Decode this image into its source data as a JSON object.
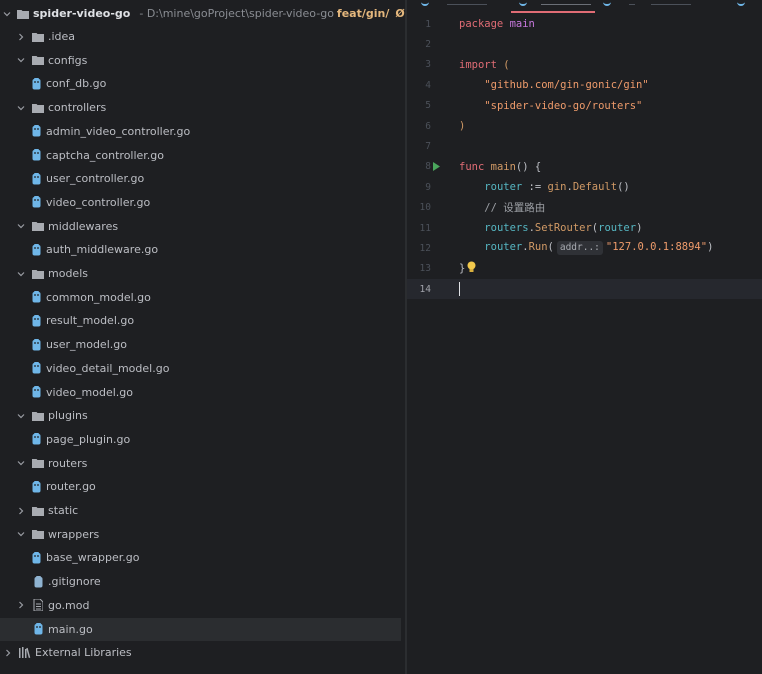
{
  "project": {
    "root_name": "spider-video-go",
    "root_path": "- D:\\mine\\goProject\\spider-video-go",
    "branch": "feat/gin/",
    "branch_symbol": "Ø",
    "items": [
      {
        "label": ".idea",
        "type": "folder",
        "expanded": false,
        "indent": 1
      },
      {
        "label": "configs",
        "type": "folder",
        "expanded": true,
        "indent": 1
      },
      {
        "label": "conf_db.go",
        "type": "gofile",
        "indent": 2
      },
      {
        "label": "controllers",
        "type": "folder",
        "expanded": true,
        "indent": 1
      },
      {
        "label": "admin_video_controller.go",
        "type": "gofile",
        "indent": 2
      },
      {
        "label": "captcha_controller.go",
        "type": "gofile",
        "indent": 2
      },
      {
        "label": "user_controller.go",
        "type": "gofile",
        "indent": 2
      },
      {
        "label": "video_controller.go",
        "type": "gofile",
        "indent": 2
      },
      {
        "label": "middlewares",
        "type": "folder",
        "expanded": true,
        "indent": 1
      },
      {
        "label": "auth_middleware.go",
        "type": "gofile",
        "indent": 2
      },
      {
        "label": "models",
        "type": "folder",
        "expanded": true,
        "indent": 1
      },
      {
        "label": "common_model.go",
        "type": "gofile",
        "indent": 2
      },
      {
        "label": "result_model.go",
        "type": "gofile",
        "indent": 2
      },
      {
        "label": "user_model.go",
        "type": "gofile",
        "indent": 2
      },
      {
        "label": "video_detail_model.go",
        "type": "gofile",
        "indent": 2
      },
      {
        "label": "video_model.go",
        "type": "gofile",
        "indent": 2
      },
      {
        "label": "plugins",
        "type": "folder",
        "expanded": true,
        "indent": 1
      },
      {
        "label": "page_plugin.go",
        "type": "gofile",
        "indent": 2
      },
      {
        "label": "routers",
        "type": "folder",
        "expanded": true,
        "indent": 1
      },
      {
        "label": "router.go",
        "type": "gofile",
        "indent": 2
      },
      {
        "label": "static",
        "type": "folder",
        "expanded": false,
        "indent": 1
      },
      {
        "label": "wrappers",
        "type": "folder",
        "expanded": true,
        "indent": 1
      },
      {
        "label": "base_wrapper.go",
        "type": "gofile",
        "indent": 2
      },
      {
        "label": ".gitignore",
        "type": "gitfile",
        "indent": 1
      },
      {
        "label": "go.mod",
        "type": "modfile",
        "expanded": false,
        "indent": 1
      },
      {
        "label": "main.go",
        "type": "gofile",
        "indent": 1,
        "selected": true
      },
      {
        "label": "External Libraries",
        "type": "libs",
        "expanded": false,
        "indent": 0
      }
    ]
  },
  "editor": {
    "current_line": 14,
    "lines": [
      {
        "n": "1",
        "tokens": [
          [
            "kw2",
            "package"
          ],
          [
            "plain",
            " "
          ],
          [
            "pkg",
            "main"
          ]
        ]
      },
      {
        "n": "2",
        "tokens": []
      },
      {
        "n": "3",
        "tokens": [
          [
            "kw2",
            "import"
          ],
          [
            "plain",
            " "
          ],
          [
            "call",
            "("
          ]
        ]
      },
      {
        "n": "4",
        "tokens": [
          [
            "plain",
            "    "
          ],
          [
            "str2",
            "\"github.com/gin-gonic/gin\""
          ]
        ]
      },
      {
        "n": "5",
        "tokens": [
          [
            "plain",
            "    "
          ],
          [
            "str2",
            "\"spider-video-go/routers\""
          ]
        ]
      },
      {
        "n": "6",
        "tokens": [
          [
            "call",
            ")"
          ]
        ]
      },
      {
        "n": "7",
        "tokens": []
      },
      {
        "n": "8",
        "tokens": [
          [
            "kw2",
            "func"
          ],
          [
            "plain",
            " "
          ],
          [
            "call",
            "main"
          ],
          [
            "plain",
            "() {"
          ]
        ],
        "run": true
      },
      {
        "n": "9",
        "tokens": [
          [
            "plain",
            "    "
          ],
          [
            "fn",
            "router"
          ],
          [
            "plain",
            " := "
          ],
          [
            "call",
            "gin"
          ],
          [
            "plain",
            "."
          ],
          [
            "call",
            "Default"
          ],
          [
            "plain",
            "()"
          ]
        ]
      },
      {
        "n": "10",
        "tokens": [
          [
            "plain",
            "    "
          ],
          [
            "cmt",
            "// 设置路由"
          ]
        ]
      },
      {
        "n": "11",
        "tokens": [
          [
            "plain",
            "    "
          ],
          [
            "fn",
            "routers"
          ],
          [
            "plain",
            "."
          ],
          [
            "call",
            "SetRouter"
          ],
          [
            "plain",
            "("
          ],
          [
            "fn",
            "router"
          ],
          [
            "plain",
            ")"
          ]
        ]
      },
      {
        "n": "12",
        "tokens": [
          [
            "plain",
            "    "
          ],
          [
            "fn",
            "router"
          ],
          [
            "plain",
            "."
          ],
          [
            "call",
            "Run"
          ],
          [
            "plain",
            "("
          ],
          [
            "hint",
            "addr..:"
          ],
          [
            "str2",
            "\"127.0.0.1:8894\""
          ],
          [
            "plain",
            ")"
          ]
        ]
      },
      {
        "n": "13",
        "tokens": [
          [
            "plain",
            "}"
          ]
        ],
        "bulb": true
      },
      {
        "n": "14",
        "tokens": [],
        "caret": true
      }
    ]
  },
  "colors": {
    "background": "#1e1f22",
    "selection": "#2b2d30",
    "go_icon": "#6fb6e8",
    "keyword": "#e06c75",
    "string": "#ee9b6b",
    "run_marker": "#4aa65c",
    "bulb": "#f2c94c"
  }
}
